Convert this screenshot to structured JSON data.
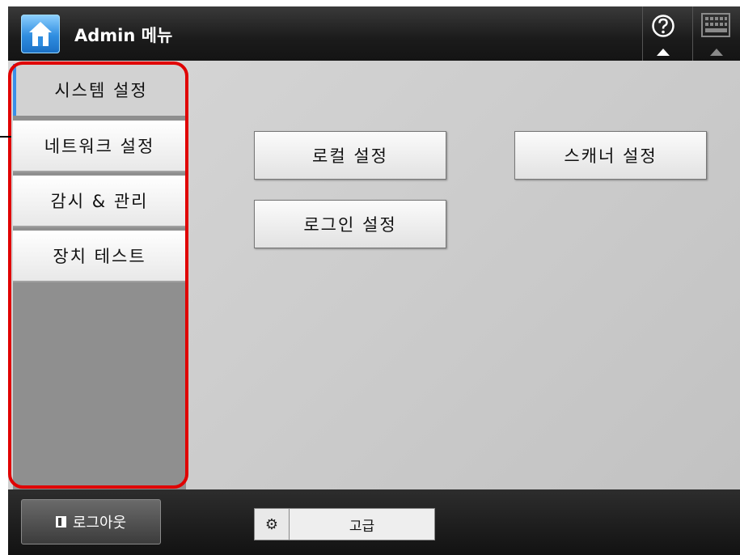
{
  "header": {
    "title": "Admin 메뉴",
    "icons": {
      "home": "home-icon",
      "help": "help-icon",
      "keyboard": "keyboard-icon"
    }
  },
  "sidebar": {
    "items": [
      {
        "label": "시스템 설정",
        "active": true
      },
      {
        "label": "네트워크 설정",
        "active": false
      },
      {
        "label": "감시 & 관리",
        "active": false
      },
      {
        "label": "장치 테스트",
        "active": false
      }
    ]
  },
  "main": {
    "buttons": [
      {
        "label": "로컬 설정"
      },
      {
        "label": "스캐너 설정"
      },
      {
        "label": "로그인 설정"
      }
    ]
  },
  "footer": {
    "logout_label": "로그아웃",
    "advanced_label": "고급",
    "icons": {
      "logout": "logout-icon",
      "gear": "gear-icon"
    }
  },
  "colors": {
    "accent": "#3b8fe8",
    "annotation": "#e00000",
    "header_bg": "#1c1c1c",
    "content_bg": "#cfcfcf"
  }
}
